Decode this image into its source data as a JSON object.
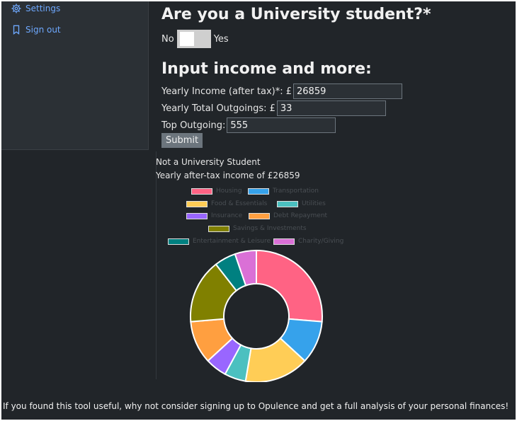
{
  "sidebar": {
    "items": [
      {
        "label": "Settings",
        "icon": "gear-icon"
      },
      {
        "label": "Sign out",
        "icon": "bookmark-icon"
      }
    ]
  },
  "main": {
    "title": "Are you a University student?*",
    "toggle_no": "No",
    "toggle_yes": "Yes",
    "subtitle": "Input income and more:",
    "fields": [
      {
        "label": "Yearly Income (after tax)*: £",
        "value": "26859"
      },
      {
        "label": "Yearly Total Outgoings: £",
        "value": "33"
      },
      {
        "label": "Top Outgoing:",
        "value": "555"
      }
    ],
    "submit_label": "Submit",
    "status": "Not a University Student",
    "income_summary": "Yearly after-tax income of £26859"
  },
  "chart_data": {
    "type": "pie",
    "donut": true,
    "categories": [
      "Housing",
      "Transportation",
      "Food & Essentials",
      "Utilities",
      "Insurance",
      "Debt Repayment",
      "Savings & Investments",
      "Entertainment & Leisure",
      "Charity/Giving"
    ],
    "values": [
      25,
      10,
      15,
      5,
      5,
      10,
      15,
      5,
      5
    ],
    "colors": [
      "#ff6384",
      "#36a2eb",
      "#ffcd56",
      "#4bc0c0",
      "#9966ff",
      "#ff9f40",
      "#808000",
      "#008080",
      "#da70d6"
    ],
    "legend_position": "top"
  },
  "footer": {
    "text": "If you found this tool useful, why not consider signing up to Opulence and get a full analysis of your personal finances!"
  }
}
